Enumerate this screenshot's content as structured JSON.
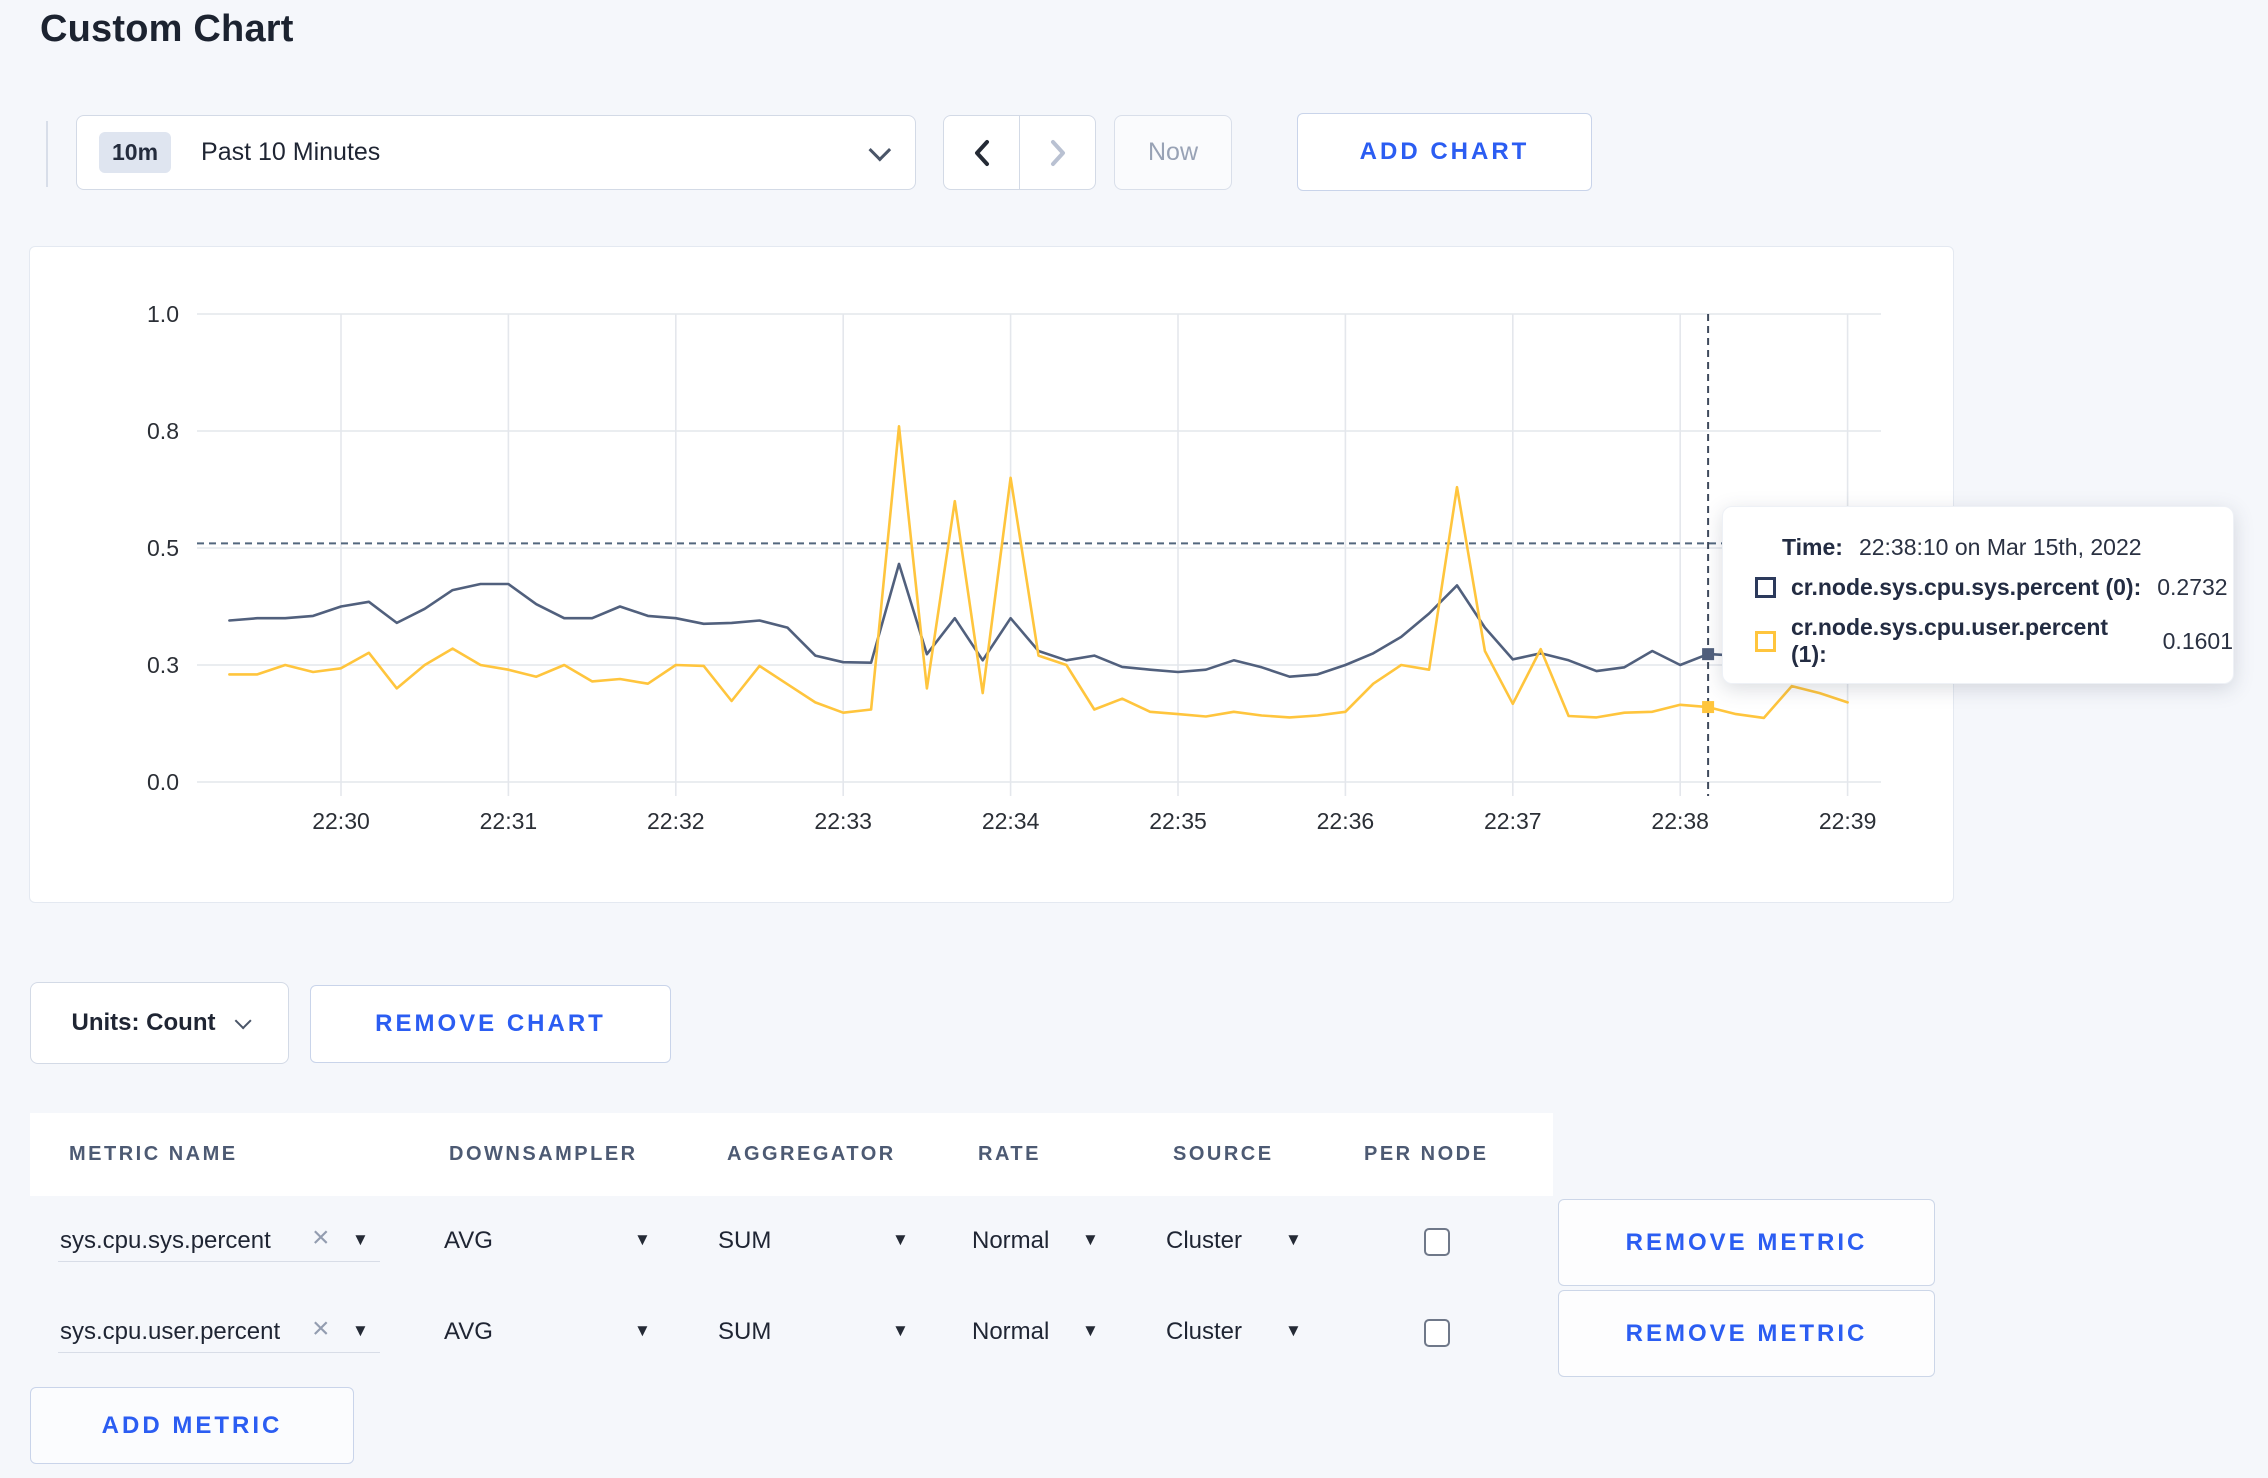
{
  "page": {
    "title": "Custom Chart"
  },
  "toolbar": {
    "range_badge": "10m",
    "range_label": "Past 10 Minutes",
    "now_label": "Now",
    "add_chart_label": "ADD CHART"
  },
  "chart_controls": {
    "units_label": "Units: Count",
    "remove_chart_label": "REMOVE CHART",
    "add_metric_label": "ADD METRIC"
  },
  "tooltip": {
    "time_label": "Time:",
    "time_value": "22:38:10 on Mar 15th, 2022",
    "series": [
      {
        "label": "cr.node.sys.cpu.sys.percent (0):",
        "value": "0.2732",
        "color": "#2c3a5c"
      },
      {
        "label": "cr.node.sys.cpu.user.percent (1):",
        "value": "0.1601",
        "color": "#ffc53d"
      }
    ]
  },
  "metrics_table": {
    "columns": [
      "METRIC NAME",
      "DOWNSAMPLER",
      "AGGREGATOR",
      "RATE",
      "SOURCE",
      "PER NODE"
    ],
    "remove_metric_label": "REMOVE METRIC",
    "rows": [
      {
        "metric_name": "sys.cpu.sys.percent",
        "downsampler": "AVG",
        "aggregator": "SUM",
        "rate": "Normal",
        "source": "Cluster",
        "per_node_checked": false
      },
      {
        "metric_name": "sys.cpu.user.percent",
        "downsampler": "AVG",
        "aggregator": "SUM",
        "rate": "Normal",
        "source": "Cluster",
        "per_node_checked": false
      }
    ]
  },
  "icons": {
    "dropdown_arrow": "▼",
    "remove_x": "×",
    "chevron_left": "‹",
    "chevron_right": "›"
  },
  "chart_data": {
    "type": "line",
    "title": "",
    "xlabel": "",
    "ylabel": "",
    "ylim": [
      0,
      1
    ],
    "grid": true,
    "x_start": "22:29:20",
    "x_interval_seconds": 10,
    "x_tick_labels": [
      "22:30",
      "22:31",
      "22:32",
      "22:33",
      "22:34",
      "22:35",
      "22:36",
      "22:37",
      "22:38",
      "22:39"
    ],
    "y_tick_values": [
      0,
      0.25,
      0.5,
      0.75,
      1.0
    ],
    "y_tick_labels": [
      "0.0",
      "0.3",
      "0.5",
      "0.8",
      "1.0"
    ],
    "crosshair": {
      "index": 53,
      "time": "22:38:10",
      "y_value": 0.51
    },
    "series": [
      {
        "name": "cr.node.sys.cpu.sys.percent",
        "color": "#51607d",
        "values": [
          0.345,
          0.35,
          0.35,
          0.355,
          0.375,
          0.385,
          0.34,
          0.37,
          0.41,
          0.423,
          0.423,
          0.38,
          0.35,
          0.35,
          0.375,
          0.355,
          0.35,
          0.338,
          0.34,
          0.345,
          0.33,
          0.27,
          0.256,
          0.255,
          0.466,
          0.273,
          0.35,
          0.26,
          0.35,
          0.28,
          0.26,
          0.27,
          0.246,
          0.24,
          0.235,
          0.24,
          0.26,
          0.245,
          0.225,
          0.23,
          0.25,
          0.275,
          0.31,
          0.36,
          0.42,
          0.33,
          0.262,
          0.275,
          0.26,
          0.237,
          0.245,
          0.28,
          0.25,
          0.2732,
          0.27,
          0.262,
          0.258,
          0.268,
          0.28
        ]
      },
      {
        "name": "cr.node.sys.cpu.user.percent",
        "color": "#ffc53d",
        "values": [
          0.23,
          0.23,
          0.25,
          0.235,
          0.243,
          0.276,
          0.2,
          0.25,
          0.285,
          0.25,
          0.24,
          0.225,
          0.25,
          0.215,
          0.22,
          0.21,
          0.25,
          0.248,
          0.173,
          0.248,
          0.209,
          0.17,
          0.148,
          0.155,
          0.76,
          0.2,
          0.6,
          0.19,
          0.65,
          0.27,
          0.25,
          0.155,
          0.178,
          0.15,
          0.145,
          0.14,
          0.15,
          0.142,
          0.138,
          0.142,
          0.15,
          0.21,
          0.25,
          0.24,
          0.63,
          0.28,
          0.167,
          0.284,
          0.141,
          0.138,
          0.148,
          0.15,
          0.165,
          0.1601,
          0.145,
          0.137,
          0.205,
          0.19,
          0.17
        ]
      }
    ]
  }
}
